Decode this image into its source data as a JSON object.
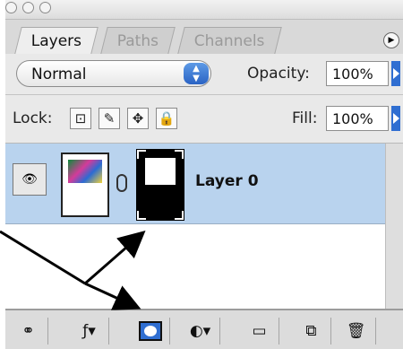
{
  "tabs": [
    {
      "label": "Layers",
      "active": true
    },
    {
      "label": "Paths",
      "active": false
    },
    {
      "label": "Channels",
      "active": false
    }
  ],
  "options": {
    "blend_mode": "Normal",
    "opacity_label": "Opacity:",
    "opacity_value": "100%",
    "lock_label": "Lock:",
    "fill_label": "Fill:",
    "fill_value": "100%"
  },
  "layers": [
    {
      "name": "Layer 0",
      "visible": true,
      "selected": true,
      "has_mask": true
    }
  ],
  "icons": {
    "menu": "panel-menu-icon",
    "eye": "eye-icon",
    "chain": "link-chain-icon",
    "lock_transparency": "lock-transparent-pixels-icon",
    "lock_image": "lock-image-pixels-icon",
    "lock_position": "lock-position-icon",
    "lock_all": "lock-all-icon",
    "toolbar": [
      "link-layers-icon",
      "layer-style-icon",
      "add-mask-icon",
      "new-adjustment-icon",
      "new-group-icon",
      "new-layer-icon",
      "trash-icon"
    ]
  },
  "colors": {
    "selection": "#b9d3ee",
    "accent": "#2f6ed1",
    "annotation_arrow": "#000000"
  }
}
